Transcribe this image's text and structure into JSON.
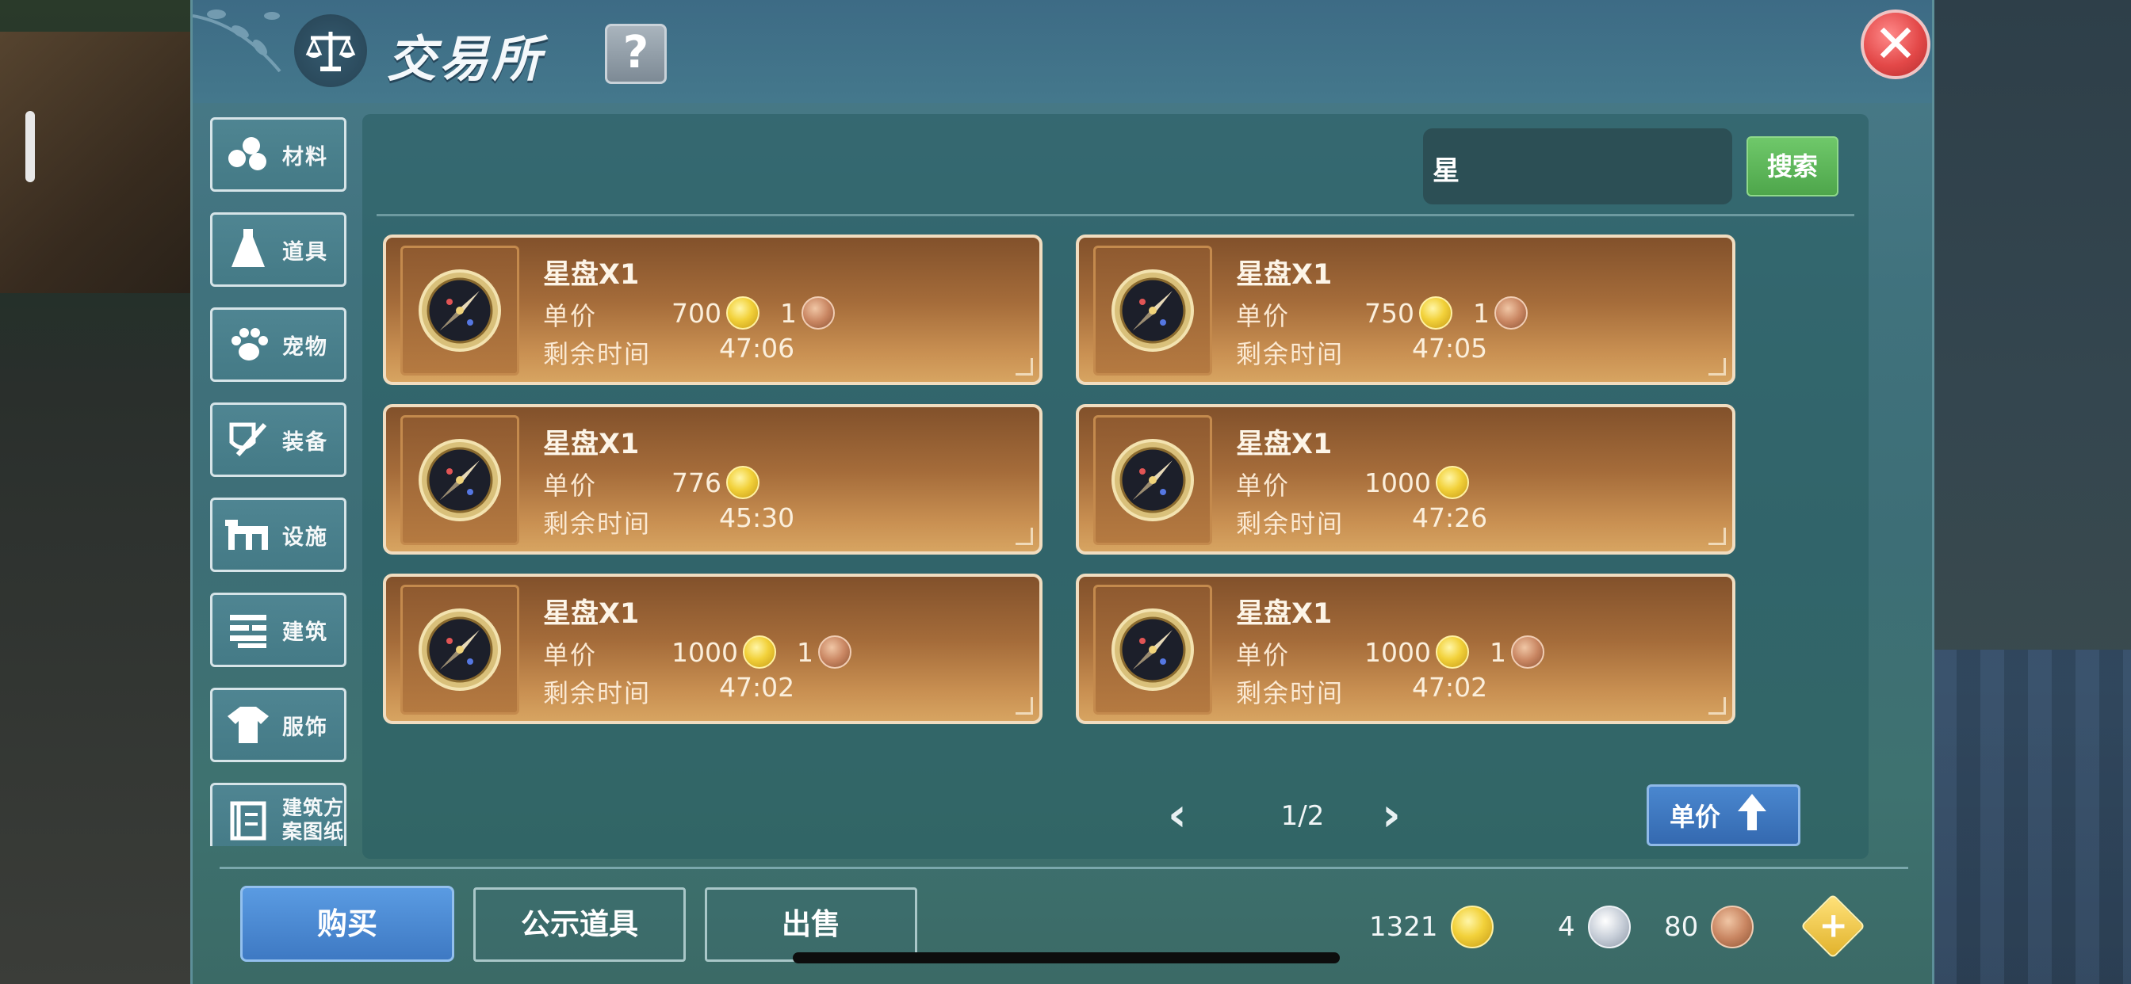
{
  "title": "交易所",
  "help_label": "?",
  "close_label": "✕",
  "categories": [
    {
      "label": "材料",
      "icon": "material-icon"
    },
    {
      "label": "道具",
      "icon": "potion-icon"
    },
    {
      "label": "宠物",
      "icon": "paw-icon"
    },
    {
      "label": "装备",
      "icon": "equipment-icon"
    },
    {
      "label": "设施",
      "icon": "facility-icon"
    },
    {
      "label": "建筑",
      "icon": "building-icon"
    },
    {
      "label": "服饰",
      "icon": "clothing-icon"
    },
    {
      "label": "建筑方案图纸",
      "line1": "建筑方",
      "line2": "案图纸",
      "icon": "blueprint-icon"
    }
  ],
  "search": {
    "value": "星",
    "button_label": "搜索"
  },
  "listing_labels": {
    "price": "单价",
    "time": "剩余时间"
  },
  "listings": [
    {
      "name": "星盘X1",
      "gold": "700",
      "bronze": "1",
      "time": "47:06"
    },
    {
      "name": "星盘X1",
      "gold": "750",
      "bronze": "1",
      "time": "47:05"
    },
    {
      "name": "星盘X1",
      "gold": "776",
      "bronze": "",
      "time": "45:30"
    },
    {
      "name": "星盘X1",
      "gold": "1000",
      "bronze": "",
      "time": "47:26"
    },
    {
      "name": "星盘X1",
      "gold": "1000",
      "bronze": "1",
      "time": "47:02"
    },
    {
      "name": "星盘X1",
      "gold": "1000",
      "bronze": "1",
      "time": "47:02"
    }
  ],
  "pager": {
    "prev": "‹",
    "page": "1/2",
    "next": "›"
  },
  "sort": {
    "label": "单价"
  },
  "tabs": {
    "buy": "购买",
    "notice": "公示道具",
    "sell": "出售"
  },
  "wallet": {
    "gold": "1321",
    "silver": "4",
    "bronze": "80"
  },
  "add_label": "+",
  "colors": {
    "gold_coin": "#f2d13a",
    "bronze_coin": "#c98662",
    "silver_coin": "#c7ced8",
    "card_bg": "#a56c3a",
    "search_button": "#4ea64b",
    "buy_tab": "#3e79c3"
  }
}
